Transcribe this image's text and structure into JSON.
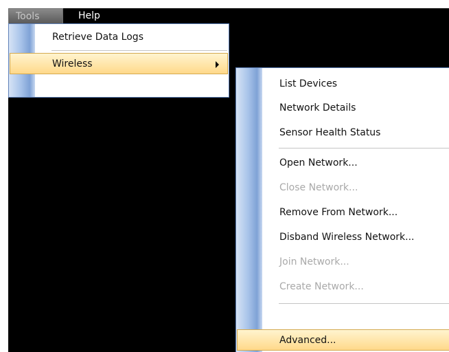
{
  "menubar": {
    "tools_label": "Tools",
    "help_label": "Help"
  },
  "tools_menu": {
    "items": [
      {
        "label": "Retrieve Data Logs",
        "enabled": true
      },
      {
        "label": "Wireless",
        "enabled": true,
        "highlighted": true,
        "has_submenu": true
      }
    ]
  },
  "wireless_menu": {
    "items": [
      {
        "label": "List Devices",
        "enabled": true
      },
      {
        "label": "Network Details",
        "enabled": true
      },
      {
        "label": "Sensor Health Status",
        "enabled": true
      },
      {
        "label": "Open Network...",
        "enabled": true
      },
      {
        "label": "Close Network...",
        "enabled": false
      },
      {
        "label": "Remove From Network...",
        "enabled": true
      },
      {
        "label": "Disband Wireless Network...",
        "enabled": true
      },
      {
        "label": "Join Network...",
        "enabled": false
      },
      {
        "label": "Create Network...",
        "enabled": false
      },
      {
        "label": "Advanced...",
        "enabled": true,
        "highlighted": true
      }
    ]
  },
  "colors": {
    "highlight": "#ffd98a",
    "gutter": "#a9c4ea",
    "disabled_text": "#a9a9a9",
    "background": "#000000"
  }
}
